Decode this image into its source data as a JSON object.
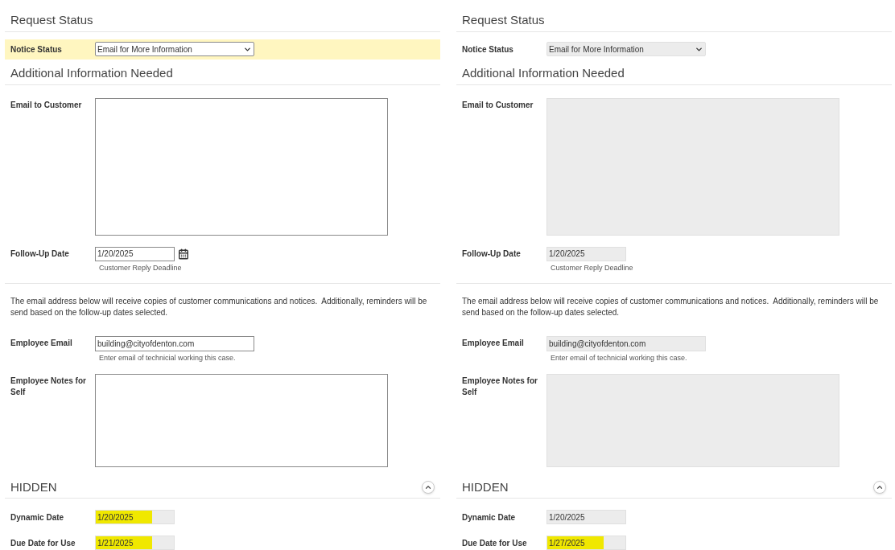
{
  "panels": [
    {
      "disabled": false,
      "request_status": {
        "title": "Request Status",
        "notice": {
          "label": "Notice Status",
          "value": "Email for More Information",
          "highlighted": true
        }
      },
      "additional": {
        "title": "Additional Information Needed",
        "email_to_customer": {
          "label": "Email to Customer"
        },
        "follow_up": {
          "label": "Follow-Up Date",
          "value": "1/20/2025",
          "hint": "Customer Reply Deadline"
        },
        "note": "The email address below will receive copies of customer communications and notices.  Additionally, reminders will be send based on the follow-up dates selected.",
        "employee_email": {
          "label": "Employee Email",
          "value": "building@cityofdenton.com",
          "hint": "Enter email of technicial working this case."
        },
        "employee_notes": {
          "label": "Employee Notes for Self"
        }
      },
      "hidden": {
        "title": "HIDDEN",
        "expanded": true,
        "fields": [
          {
            "label": "Dynamic Date",
            "value": "1/20/2025",
            "highlighted": true
          },
          {
            "label": "Due Date for Use",
            "value": "1/21/2025",
            "highlighted": true
          }
        ]
      }
    },
    {
      "disabled": true,
      "request_status": {
        "title": "Request Status",
        "notice": {
          "label": "Notice Status",
          "value": "Email for More Information",
          "highlighted": false
        }
      },
      "additional": {
        "title": "Additional Information Needed",
        "email_to_customer": {
          "label": "Email to Customer"
        },
        "follow_up": {
          "label": "Follow-Up Date",
          "value": "1/20/2025",
          "hint": "Customer Reply Deadline"
        },
        "note": "The email address below will receive copies of customer communications and notices.  Additionally, reminders will be send based on the follow-up dates selected.",
        "employee_email": {
          "label": "Employee Email",
          "value": "building@cityofdenton.com",
          "hint": "Enter email of technicial working this case."
        },
        "employee_notes": {
          "label": "Employee Notes for Self"
        }
      },
      "hidden": {
        "title": "HIDDEN",
        "expanded": true,
        "fields": [
          {
            "label": "Dynamic Date",
            "value": "1/20/2025",
            "highlighted": false
          },
          {
            "label": "Due Date for Use",
            "value": "1/27/2025",
            "highlighted": true
          }
        ]
      }
    }
  ]
}
